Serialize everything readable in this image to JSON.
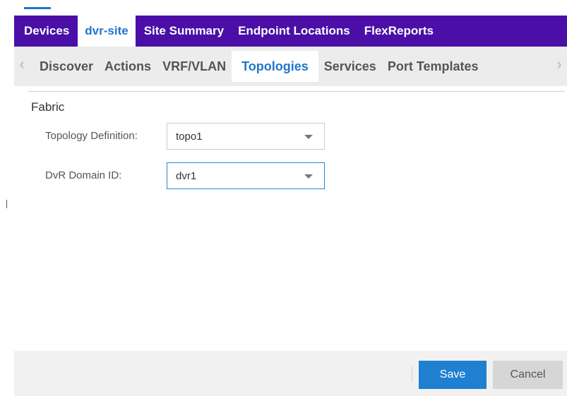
{
  "tabs_primary": [
    {
      "label": "Devices",
      "active": false
    },
    {
      "label": "dvr-site",
      "active": true
    },
    {
      "label": "Site Summary",
      "active": false
    },
    {
      "label": "Endpoint Locations",
      "active": false
    },
    {
      "label": "FlexReports",
      "active": false
    }
  ],
  "tabs_secondary": [
    {
      "label": "Discover",
      "active": false
    },
    {
      "label": "Actions",
      "active": false
    },
    {
      "label": "VRF/VLAN",
      "active": false
    },
    {
      "label": "Topologies",
      "active": true
    },
    {
      "label": "Services",
      "active": false
    },
    {
      "label": "Port Templates",
      "active": false
    }
  ],
  "arrows": {
    "left": "‹",
    "right": "›"
  },
  "section": {
    "title": "Fabric"
  },
  "fields": {
    "topology_definition": {
      "label": "Topology Definition:",
      "value": "topo1"
    },
    "dvr_domain_id": {
      "label": "DvR Domain ID:",
      "value": "dvr1"
    }
  },
  "footer": {
    "save_label": "Save",
    "cancel_label": "Cancel"
  },
  "colors": {
    "primary_bar": "#4b0fa8",
    "accent": "#1f77c9",
    "save_button": "#1f7fd0",
    "cancel_button": "#d6d6d6"
  },
  "icons": {
    "scroll_left": "chevron-left-icon",
    "scroll_right": "chevron-right-icon",
    "dropdown": "caret-down-icon"
  }
}
